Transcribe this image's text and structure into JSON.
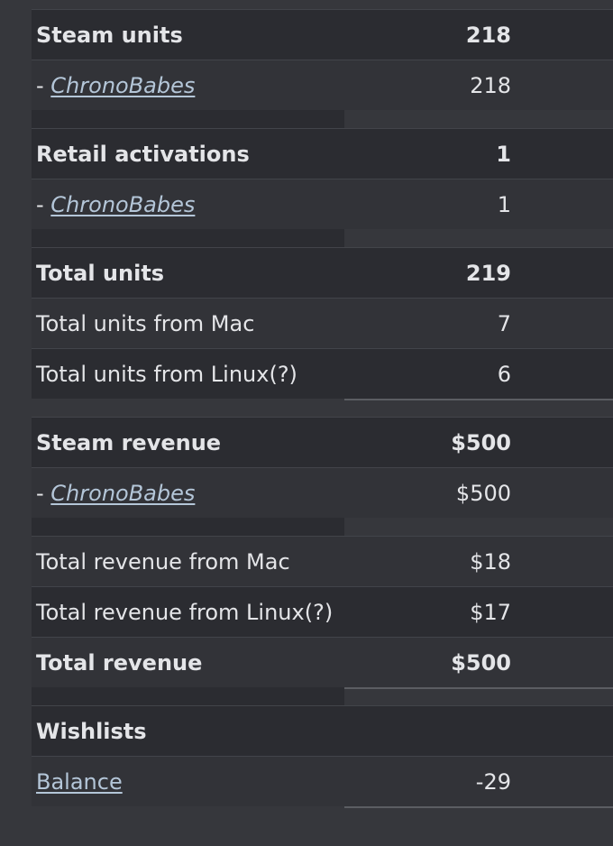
{
  "groups": [
    {
      "rows": [
        {
          "label": "Steam units",
          "value": "218",
          "bold": true
        },
        {
          "prefix": "- ",
          "label": "ChronoBabes",
          "value": "218",
          "link": true
        }
      ]
    },
    {
      "rows": [
        {
          "label": "Retail activations",
          "value": "1",
          "bold": true
        },
        {
          "prefix": "- ",
          "label": "ChronoBabes",
          "value": "1",
          "link": true
        }
      ]
    },
    {
      "rows": [
        {
          "label": "Total units",
          "value": "219",
          "bold": true
        },
        {
          "label": "Total units from Mac",
          "value": "7"
        },
        {
          "label": "Total units from Linux(?)",
          "value": "6"
        }
      ]
    },
    {
      "rows": [
        {
          "label": "Steam revenue",
          "value": "$500",
          "bold": true
        },
        {
          "prefix": "- ",
          "label": "ChronoBabes",
          "value": "$500",
          "link": true
        }
      ]
    },
    {
      "rows": [
        {
          "label": "Total revenue from Mac",
          "value": "$18"
        },
        {
          "label": "Total revenue from Linux(?)",
          "value": "$17"
        },
        {
          "label": "Total revenue",
          "value": "$500",
          "bold": true
        }
      ]
    },
    {
      "rows": [
        {
          "label": "Wishlists",
          "value": "",
          "bold": true
        },
        {
          "label": "Balance",
          "value": "-29",
          "link": true,
          "plain": true
        }
      ]
    }
  ]
}
